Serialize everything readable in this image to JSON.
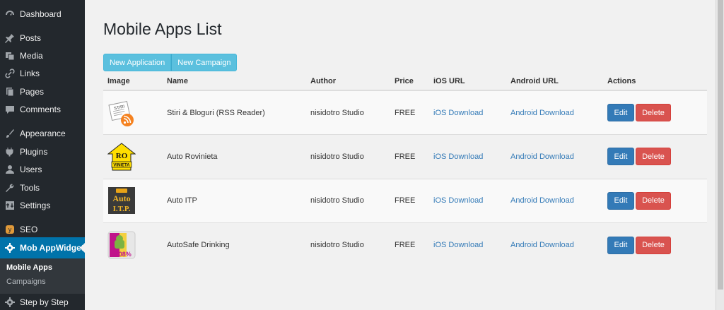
{
  "sidebar": {
    "items": [
      {
        "label": "Dashboard",
        "icon": "dashboard-icon"
      },
      {
        "label": "Posts",
        "icon": "pin-icon"
      },
      {
        "label": "Media",
        "icon": "media-icon"
      },
      {
        "label": "Links",
        "icon": "link-icon"
      },
      {
        "label": "Pages",
        "icon": "pages-icon"
      },
      {
        "label": "Comments",
        "icon": "comment-icon"
      },
      {
        "label": "Appearance",
        "icon": "brush-icon"
      },
      {
        "label": "Plugins",
        "icon": "plugin-icon"
      },
      {
        "label": "Users",
        "icon": "user-icon"
      },
      {
        "label": "Tools",
        "icon": "wrench-icon"
      },
      {
        "label": "Settings",
        "icon": "settings-icon"
      },
      {
        "label": "SEO",
        "icon": "seo-icon"
      },
      {
        "label": "Mob AppWidget",
        "icon": "gear-icon"
      },
      {
        "label": "Step by Step",
        "icon": "gear-icon"
      }
    ],
    "submenu": [
      {
        "label": "Mobile Apps"
      },
      {
        "label": "Campaigns"
      }
    ]
  },
  "main": {
    "title": "Mobile Apps List",
    "buttons": {
      "new_application": "New Application",
      "new_campaign": "New Campaign"
    },
    "table": {
      "headers": [
        "Image",
        "Name",
        "Author",
        "Price",
        "iOS URL",
        "Android URL",
        "Actions"
      ],
      "rows": [
        {
          "name": "Stiri & Bloguri (RSS Reader)",
          "author": "nisidotro Studio",
          "price": "FREE",
          "ios": "iOS Download",
          "android": "Android Download",
          "edit": "Edit",
          "delete": "Delete",
          "icon": "rss-reader-icon",
          "icon_text": "STIRI"
        },
        {
          "name": "Auto Rovinieta",
          "author": "nisidotro Studio",
          "price": "FREE",
          "ios": "iOS Download",
          "android": "Android Download",
          "edit": "Edit",
          "delete": "Delete",
          "icon": "rovinieta-icon",
          "icon_text": "RO",
          "icon_subtext": "VINIETA"
        },
        {
          "name": "Auto ITP",
          "author": "nisidotro Studio",
          "price": "FREE",
          "ios": "iOS Download",
          "android": "Android Download",
          "edit": "Edit",
          "delete": "Delete",
          "icon": "auto-itp-icon",
          "icon_text": "Auto",
          "icon_subtext": "I.T.P."
        },
        {
          "name": "AutoSafe Drinking",
          "author": "nisidotro Studio",
          "price": "FREE",
          "ios": "iOS Download",
          "android": "Android Download",
          "edit": "Edit",
          "delete": "Delete",
          "icon": "autosafe-icon",
          "icon_text": "0.08%"
        }
      ]
    }
  },
  "colors": {
    "sidebar_bg": "#23282d",
    "active": "#0073aa",
    "info": "#5bc0de",
    "primary": "#337ab7",
    "danger": "#d9534f"
  }
}
